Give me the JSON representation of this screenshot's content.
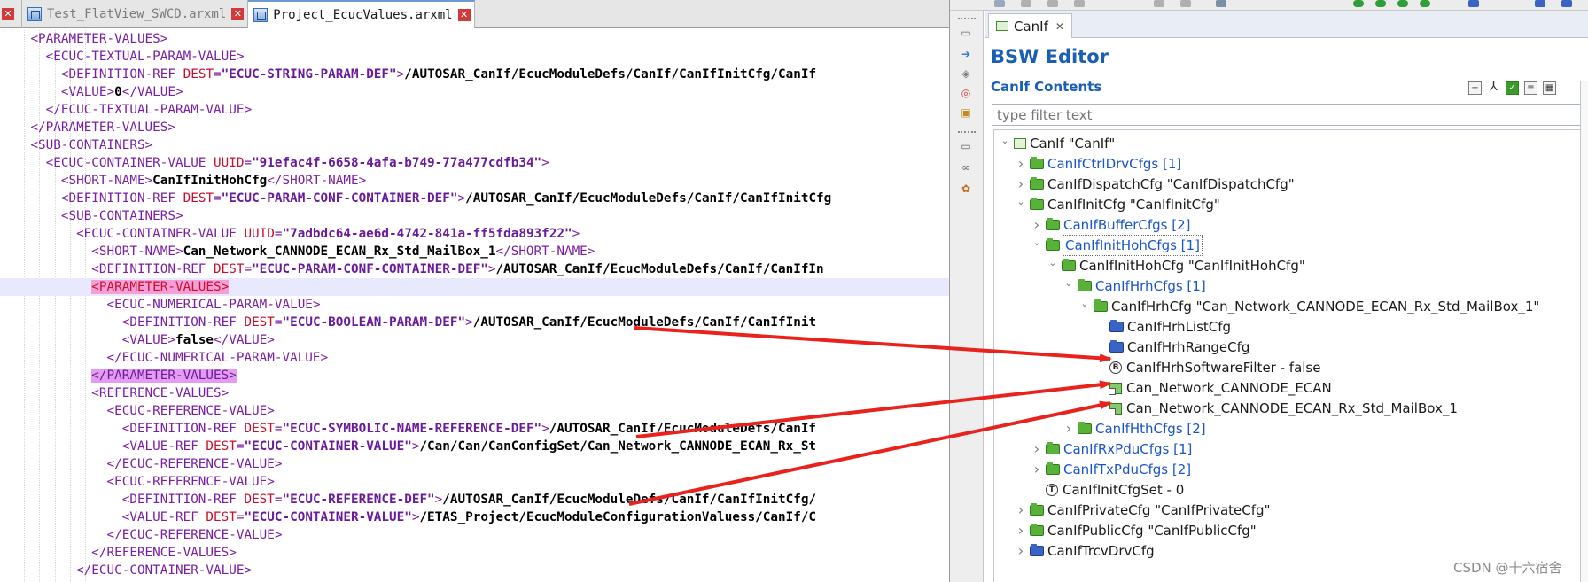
{
  "editor_tabs": [
    {
      "label": "Test_FlatView_SWCD.arxml",
      "active": false
    },
    {
      "label": "Project_EcucValues.arxml",
      "active": true
    }
  ],
  "xml_lines": [
    {
      "indent": 2,
      "parts": [
        {
          "k": "t",
          "s": "<PARAMETER-VALUES>"
        }
      ]
    },
    {
      "indent": 3,
      "parts": [
        {
          "k": "t",
          "s": "<ECUC-TEXTUAL-PARAM-VALUE>"
        }
      ]
    },
    {
      "indent": 4,
      "parts": [
        {
          "k": "t",
          "s": "<DEFINITION-REF "
        },
        {
          "k": "a",
          "s": "DEST"
        },
        {
          "k": "t",
          "s": "="
        },
        {
          "k": "v",
          "s": "\"ECUC-STRING-PARAM-DEF\""
        },
        {
          "k": "t",
          "s": ">"
        },
        {
          "k": "b",
          "s": "/AUTOSAR_CanIf/EcucModuleDefs/CanIf/CanIfInitCfg/CanIf"
        }
      ]
    },
    {
      "indent": 4,
      "parts": [
        {
          "k": "t",
          "s": "<VALUE>"
        },
        {
          "k": "b",
          "s": "0"
        },
        {
          "k": "t",
          "s": "</VALUE>"
        }
      ]
    },
    {
      "indent": 3,
      "parts": [
        {
          "k": "t",
          "s": "</ECUC-TEXTUAL-PARAM-VALUE>"
        }
      ]
    },
    {
      "indent": 2,
      "parts": [
        {
          "k": "t",
          "s": "</PARAMETER-VALUES>"
        }
      ]
    },
    {
      "indent": 2,
      "parts": [
        {
          "k": "t",
          "s": "<SUB-CONTAINERS>"
        }
      ]
    },
    {
      "indent": 3,
      "parts": [
        {
          "k": "t",
          "s": "<ECUC-CONTAINER-VALUE "
        },
        {
          "k": "a",
          "s": "UUID"
        },
        {
          "k": "t",
          "s": "="
        },
        {
          "k": "v",
          "s": "\"91efac4f-6658-4afa-b749-77a477cdfb34\""
        },
        {
          "k": "t",
          "s": ">"
        }
      ]
    },
    {
      "indent": 4,
      "parts": [
        {
          "k": "t",
          "s": "<SHORT-NAME>"
        },
        {
          "k": "b",
          "s": "CanIfInitHohCfg"
        },
        {
          "k": "t",
          "s": "</SHORT-NAME>"
        }
      ]
    },
    {
      "indent": 4,
      "parts": [
        {
          "k": "t",
          "s": "<DEFINITION-REF "
        },
        {
          "k": "a",
          "s": "DEST"
        },
        {
          "k": "t",
          "s": "="
        },
        {
          "k": "v",
          "s": "\"ECUC-PARAM-CONF-CONTAINER-DEF\""
        },
        {
          "k": "t",
          "s": ">"
        },
        {
          "k": "b",
          "s": "/AUTOSAR_CanIf/EcucModuleDefs/CanIf/CanIfInitCfg"
        }
      ]
    },
    {
      "indent": 4,
      "parts": [
        {
          "k": "t",
          "s": "<SUB-CONTAINERS>"
        }
      ]
    },
    {
      "indent": 5,
      "parts": [
        {
          "k": "t",
          "s": "<ECUC-CONTAINER-VALUE "
        },
        {
          "k": "a",
          "s": "UUID"
        },
        {
          "k": "t",
          "s": "="
        },
        {
          "k": "v",
          "s": "\"7adbdc64-ae6d-4742-841a-ff5fda893f22\""
        },
        {
          "k": "t",
          "s": ">"
        }
      ]
    },
    {
      "indent": 6,
      "parts": [
        {
          "k": "t",
          "s": "<SHORT-NAME>"
        },
        {
          "k": "b",
          "s": "Can_Network_CANNODE_ECAN_Rx_Std_MailBox_1"
        },
        {
          "k": "t",
          "s": "</SHORT-NAME>"
        }
      ]
    },
    {
      "indent": 6,
      "parts": [
        {
          "k": "t",
          "s": "<DEFINITION-REF "
        },
        {
          "k": "a",
          "s": "DEST"
        },
        {
          "k": "t",
          "s": "="
        },
        {
          "k": "v",
          "s": "\"ECUC-PARAM-CONF-CONTAINER-DEF\""
        },
        {
          "k": "t",
          "s": ">"
        },
        {
          "k": "b",
          "s": "/AUTOSAR_CanIf/EcucModuleDefs/CanIf/CanIfIn"
        }
      ]
    },
    {
      "indent": 6,
      "hl": true,
      "parts": [
        {
          "k": "m1",
          "s": "<PARAMETER-VALUES>"
        }
      ]
    },
    {
      "indent": 7,
      "parts": [
        {
          "k": "t",
          "s": "<ECUC-NUMERICAL-PARAM-VALUE>"
        }
      ]
    },
    {
      "indent": 8,
      "parts": [
        {
          "k": "t",
          "s": "<DEFINITION-REF "
        },
        {
          "k": "a",
          "s": "DEST"
        },
        {
          "k": "t",
          "s": "="
        },
        {
          "k": "v",
          "s": "\"ECUC-BOOLEAN-PARAM-DEF\""
        },
        {
          "k": "t",
          "s": ">"
        },
        {
          "k": "b",
          "s": "/AUTOSAR_CanIf/EcucModuleDefs/CanIf/CanIfInit"
        }
      ]
    },
    {
      "indent": 8,
      "parts": [
        {
          "k": "t",
          "s": "<VALUE>"
        },
        {
          "k": "b",
          "s": "false"
        },
        {
          "k": "t",
          "s": "</VALUE>"
        }
      ]
    },
    {
      "indent": 7,
      "parts": [
        {
          "k": "t",
          "s": "</ECUC-NUMERICAL-PARAM-VALUE>"
        }
      ]
    },
    {
      "indent": 6,
      "parts": [
        {
          "k": "m2",
          "s": "</PARAMETER-VALUES>"
        }
      ]
    },
    {
      "indent": 6,
      "parts": [
        {
          "k": "t",
          "s": "<REFERENCE-VALUES>"
        }
      ]
    },
    {
      "indent": 7,
      "parts": [
        {
          "k": "t",
          "s": "<ECUC-REFERENCE-VALUE>"
        }
      ]
    },
    {
      "indent": 8,
      "parts": [
        {
          "k": "t",
          "s": "<DEFINITION-REF "
        },
        {
          "k": "a",
          "s": "DEST"
        },
        {
          "k": "t",
          "s": "="
        },
        {
          "k": "v",
          "s": "\"ECUC-SYMBOLIC-NAME-REFERENCE-DEF\""
        },
        {
          "k": "t",
          "s": ">"
        },
        {
          "k": "b",
          "s": "/AUTOSAR_CanIf/EcucModuleDefs/CanIf"
        }
      ]
    },
    {
      "indent": 8,
      "parts": [
        {
          "k": "t",
          "s": "<VALUE-REF "
        },
        {
          "k": "a",
          "s": "DEST"
        },
        {
          "k": "t",
          "s": "="
        },
        {
          "k": "v",
          "s": "\"ECUC-CONTAINER-VALUE\""
        },
        {
          "k": "t",
          "s": ">"
        },
        {
          "k": "b",
          "s": "/Can/Can/CanConfigSet/Can_Network_CANNODE_ECAN_Rx_St"
        }
      ]
    },
    {
      "indent": 7,
      "parts": [
        {
          "k": "t",
          "s": "</ECUC-REFERENCE-VALUE>"
        }
      ]
    },
    {
      "indent": 7,
      "parts": [
        {
          "k": "t",
          "s": "<ECUC-REFERENCE-VALUE>"
        }
      ]
    },
    {
      "indent": 8,
      "parts": [
        {
          "k": "t",
          "s": "<DEFINITION-REF "
        },
        {
          "k": "a",
          "s": "DEST"
        },
        {
          "k": "t",
          "s": "="
        },
        {
          "k": "v",
          "s": "\"ECUC-REFERENCE-DEF\""
        },
        {
          "k": "t",
          "s": ">"
        },
        {
          "k": "b",
          "s": "/AUTOSAR_CanIf/EcucModuleDefs/CanIf/CanIfInitCfg/"
        }
      ]
    },
    {
      "indent": 8,
      "parts": [
        {
          "k": "t",
          "s": "<VALUE-REF "
        },
        {
          "k": "a",
          "s": "DEST"
        },
        {
          "k": "t",
          "s": "="
        },
        {
          "k": "v",
          "s": "\"ECUC-CONTAINER-VALUE\""
        },
        {
          "k": "t",
          "s": ">"
        },
        {
          "k": "b",
          "s": "/ETAS_Project/EcucModuleConfigurationValuess/CanIf/C"
        }
      ]
    },
    {
      "indent": 7,
      "parts": [
        {
          "k": "t",
          "s": "</ECUC-REFERENCE-VALUE>"
        }
      ]
    },
    {
      "indent": 6,
      "parts": [
        {
          "k": "t",
          "s": "</REFERENCE-VALUES>"
        }
      ]
    },
    {
      "indent": 5,
      "parts": [
        {
          "k": "t",
          "s": "</ECUC-CONTAINER-VALUE>"
        }
      ]
    }
  ],
  "view_tab": {
    "label": "CanIf",
    "close": "✕"
  },
  "editor_title": "BSW Editor",
  "contents_title": "CanIf Contents",
  "filter": {
    "placeholder": "type filter text"
  },
  "tree": [
    {
      "level": 0,
      "chev": "v",
      "icon": "square",
      "label": "CanIf \"CanIf\""
    },
    {
      "level": 1,
      "chev": ">",
      "icon": "green",
      "label": "CanIfCtrlDrvCfgs [1]",
      "link": true
    },
    {
      "level": 1,
      "chev": ">",
      "icon": "green",
      "label": "CanIfDispatchCfg \"CanIfDispatchCfg\""
    },
    {
      "level": 1,
      "chev": "v",
      "icon": "green",
      "label": "CanIfInitCfg \"CanIfInitCfg\""
    },
    {
      "level": 2,
      "chev": ">",
      "icon": "green",
      "label": "CanIfBufferCfgs [2]",
      "link": true
    },
    {
      "level": 2,
      "chev": "v",
      "icon": "green",
      "label": "CanIfInitHohCfgs [1]",
      "link": true,
      "selected": true
    },
    {
      "level": 3,
      "chev": "v",
      "icon": "green",
      "label": "CanIfInitHohCfg \"CanIfInitHohCfg\""
    },
    {
      "level": 4,
      "chev": "v",
      "icon": "green",
      "label": "CanIfHrhCfgs [1]",
      "link": true
    },
    {
      "level": 5,
      "chev": "v",
      "icon": "green",
      "label": "CanIfHrhCfg \"Can_Network_CANNODE_ECAN_Rx_Std_MailBox_1\""
    },
    {
      "level": 6,
      "chev": "",
      "icon": "blue",
      "label": "CanIfHrhListCfg"
    },
    {
      "level": 6,
      "chev": "",
      "icon": "blue",
      "label": "CanIfHrhRangeCfg"
    },
    {
      "level": 6,
      "chev": "",
      "icon": "param",
      "param_letter": "B",
      "label": "CanIfHrhSoftwareFilter - false"
    },
    {
      "level": 6,
      "chev": "",
      "icon": "ref",
      "label": "Can_Network_CANNODE_ECAN"
    },
    {
      "level": 6,
      "chev": "",
      "icon": "ref",
      "label": "Can_Network_CANNODE_ECAN_Rx_Std_MailBox_1"
    },
    {
      "level": 4,
      "chev": ">",
      "icon": "green",
      "label": "CanIfHthCfgs [2]",
      "link": true
    },
    {
      "level": 2,
      "chev": ">",
      "icon": "green",
      "label": "CanIfRxPduCfgs [1]",
      "link": true
    },
    {
      "level": 2,
      "chev": ">",
      "icon": "green",
      "label": "CanIfTxPduCfgs [2]",
      "link": true
    },
    {
      "level": 2,
      "chev": "",
      "icon": "param",
      "param_letter": "T",
      "label": "CanIfInitCfgSet - 0"
    },
    {
      "level": 1,
      "chev": ">",
      "icon": "green",
      "label": "CanIfPrivateCfg \"CanIfPrivateCfg\""
    },
    {
      "level": 1,
      "chev": ">",
      "icon": "green",
      "label": "CanIfPublicCfg \"CanIfPublicCfg\""
    },
    {
      "level": 1,
      "chev": ">",
      "icon": "blue",
      "label": "CanIfTrcvDrvCfg"
    }
  ],
  "watermark": "CSDN @十六宿舍",
  "colors": {
    "arrow": "#e8231e",
    "link": "#1a55c9",
    "title": "#1a5fb4"
  }
}
